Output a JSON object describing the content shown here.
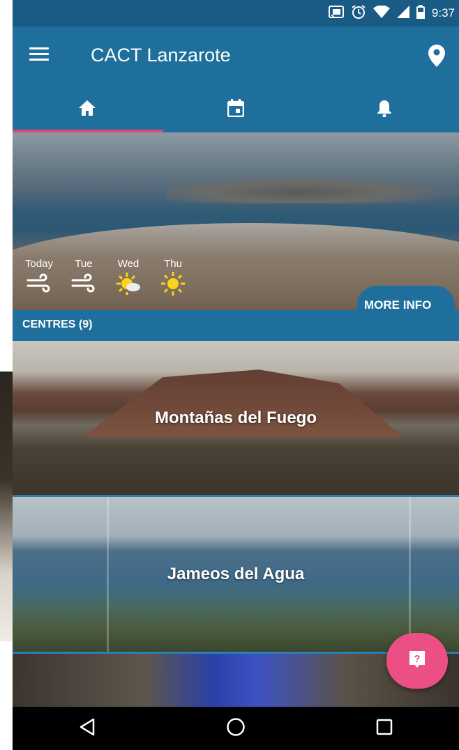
{
  "status_bar": {
    "time": "9:37",
    "icons": [
      "cast-icon",
      "alarm-icon",
      "wifi-icon",
      "signal-icon",
      "battery-icon"
    ]
  },
  "app_bar": {
    "title": "CACT Lanzarote",
    "menu_icon": "menu-icon",
    "action_icon": "location-pin-icon"
  },
  "tabs": [
    {
      "icon": "home-icon",
      "selected": true
    },
    {
      "icon": "calendar-icon",
      "selected": false
    },
    {
      "icon": "bell-icon",
      "selected": false
    }
  ],
  "forecast": [
    {
      "day": "Today",
      "icon": "wind-icon"
    },
    {
      "day": "Tue",
      "icon": "wind-icon"
    },
    {
      "day": "Wed",
      "icon": "partly-sunny-icon"
    },
    {
      "day": "Thu",
      "icon": "sun-icon"
    }
  ],
  "more_info_label": "MORE INFO",
  "centres": {
    "header": "CENTRES (9)",
    "items": [
      {
        "name": "Montañas del Fuego"
      },
      {
        "name": "Jameos del Agua"
      }
    ]
  },
  "fab_icon": "help-icon",
  "colors": {
    "primary": "#1e6f9c",
    "status_bar": "#195b85",
    "accent": "#ec4f84",
    "sun": "#ffd21a"
  },
  "nav_bar": [
    "back-icon",
    "home-circle-icon",
    "recents-icon"
  ]
}
